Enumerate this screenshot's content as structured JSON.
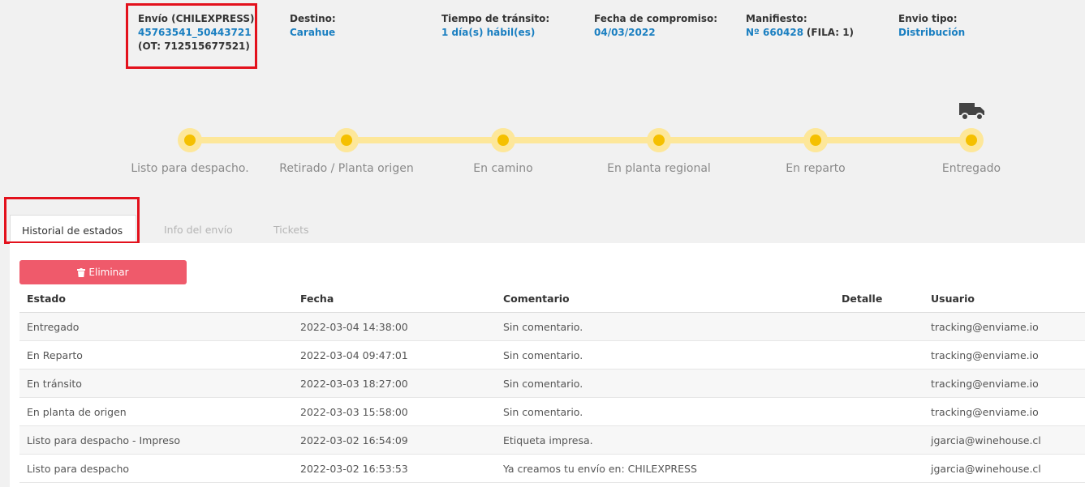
{
  "shipment": {
    "envio_label": "Envío (CHILEXPRESS):",
    "envio_value": "45763541_50443721",
    "envio_ot": "(OT: 712515677521)",
    "destino_label": "Destino:",
    "destino_value": "Carahue",
    "transito_label": "Tiempo de tránsito:",
    "transito_value": "1 día(s) hábil(es)",
    "compromiso_label": "Fecha de compromiso:",
    "compromiso_value": "04/03/2022",
    "manifiesto_label": "Manifiesto:",
    "manifiesto_value": "Nº 660428",
    "manifiesto_fila": "(FILA: 1)",
    "tipo_label": "Envio tipo:",
    "tipo_value": "Distribución"
  },
  "progress": {
    "steps": [
      "Listo para despacho.",
      "Retirado / Planta origen",
      "En camino",
      "En planta regional",
      "En reparto",
      "Entregado"
    ],
    "current_icon": "truck-icon"
  },
  "tabs": [
    "Historial de estados",
    "Info del envío",
    "Tickets"
  ],
  "actions": {
    "delete_label": "Eliminar",
    "delete_icon": "trash-icon"
  },
  "history": {
    "columns": [
      "Estado",
      "Fecha",
      "Comentario",
      "Detalle",
      "Usuario"
    ],
    "rows": [
      [
        "Entregado",
        "2022-03-04 14:38:00",
        "Sin comentario.",
        "",
        "tracking@enviame.io"
      ],
      [
        "En Reparto",
        "2022-03-04 09:47:01",
        "Sin comentario.",
        "",
        "tracking@enviame.io"
      ],
      [
        "En tránsito",
        "2022-03-03 18:27:00",
        "Sin comentario.",
        "",
        "tracking@enviame.io"
      ],
      [
        "En planta de origen",
        "2022-03-03 15:58:00",
        "Sin comentario.",
        "",
        "tracking@enviame.io"
      ],
      [
        "Listo para despacho - Impreso",
        "2022-03-02 16:54:09",
        "Etiqueta impresa.",
        "",
        "jgarcia@winehouse.cl"
      ],
      [
        "Listo para despacho",
        "2022-03-02 16:53:53",
        "Ya creamos tu envío en: CHILEXPRESS",
        "",
        "jgarcia@winehouse.cl"
      ]
    ]
  },
  "colors": {
    "accent_blue": "#1a7fc1",
    "highlight_red": "#e3111c",
    "step_yellow": "#f5c000",
    "delete_button": "#ef5a6b"
  }
}
